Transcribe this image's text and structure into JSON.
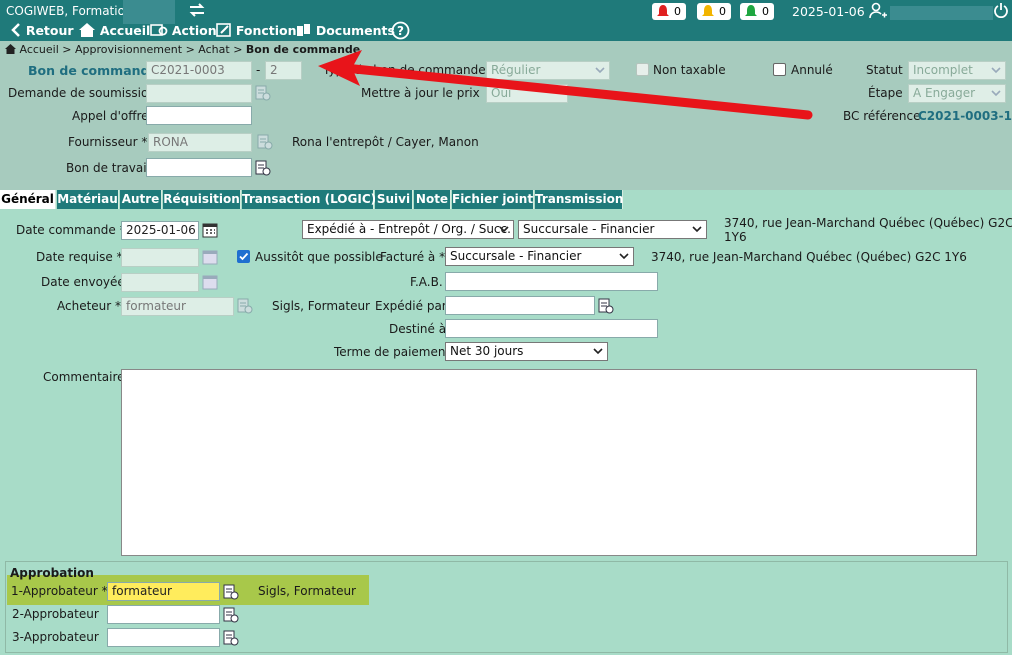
{
  "app": {
    "title": "COGIWEB, Formation"
  },
  "nav": {
    "back": "Retour",
    "home": "Accueil",
    "action": "Action",
    "function": "Fonction",
    "documents": "Documents"
  },
  "alerts": {
    "red": "0",
    "yellow": "0",
    "green": "0"
  },
  "header_date": "2025-01-06",
  "breadcrumb": {
    "home": "Accueil",
    "sep": ">",
    "l1": "Approvisionnement",
    "l2": "Achat",
    "current": "Bon de commande"
  },
  "form": {
    "bc_label": "Bon de commande",
    "bc_number": "C2021-0003",
    "bc_dash": "-",
    "bc_seq": "2",
    "type_label": "Type de bon de commande *",
    "type_value": "Régulier",
    "non_taxable": "Non taxable",
    "annule": "Annulé",
    "statut_label": "Statut",
    "statut_value": "Incomplet",
    "demande_label": "Demande de soumission",
    "maj_prix_label": "Mettre à jour le prix",
    "maj_prix_value": "Oui",
    "etape_label": "Étape",
    "etape_value": "A Engager",
    "appel_label": "Appel d'offre",
    "bc_ref_label": "BC référence",
    "bc_ref_value": "C2021-0003-1",
    "fournisseur_label": "Fournisseur *",
    "fournisseur_value": "RONA",
    "fournisseur_desc": "Rona l'entrepôt / Cayer, Manon",
    "bon_travail_label": "Bon de travail"
  },
  "tabs": [
    "Général",
    "Matériau",
    "Autre",
    "Réquisition",
    "Transaction (LOGIC)",
    "Suivi",
    "Note",
    "Fichier joint",
    "Transmission"
  ],
  "general": {
    "date_cmd_label": "Date commande *",
    "date_cmd_value": "2025-01-06",
    "expedie_select": "Expédié à - Entrepôt / Org. / Succ.",
    "succursale_select": "Succursale - Financier",
    "address_line1": "3740, rue Jean-Marchand Québec (Québec) G2C",
    "address_line2": "1Y6",
    "date_req_label": "Date requise *",
    "aussitot": "Aussitôt que possible",
    "facture_label": "Facturé à *",
    "facture_value": "Succursale - Financier",
    "facture_address": "3740, rue Jean-Marchand Québec (Québec) G2C 1Y6",
    "date_env_label": "Date envoyée",
    "fab_label": "F.A.B.",
    "acheteur_label": "Acheteur *",
    "acheteur_value": "formateur",
    "acheteur_desc": "Sigls, Formateur",
    "expedie_par_label": "Expédié par",
    "destine_label": "Destiné à",
    "terme_label": "Terme de paiement",
    "terme_value": "Net 30 jours",
    "commentaire_label": "Commentaire"
  },
  "approbation": {
    "title": "Approbation",
    "a1_label": "1-Approbateur *",
    "a1_value": "formateur",
    "a1_desc": "Sigls, Formateur",
    "a2_label": "2-Approbateur",
    "a3_label": "3-Approbateur"
  },
  "colors": {
    "teal": "#1f7a7a",
    "panel": "#a8dcc8",
    "upper": "#a7cbbe",
    "arrow": "#e8141a",
    "highlight": "#a8c84a",
    "field_highlight": "#ffec5c"
  }
}
